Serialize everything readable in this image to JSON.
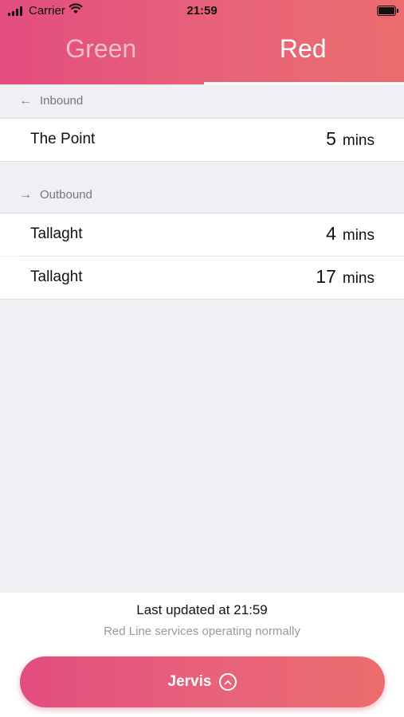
{
  "status_bar": {
    "carrier": "Carrier",
    "time": "21:59",
    "signal_icon": "cellular-signal-icon",
    "wifi_icon": "wifi-icon",
    "battery_icon": "battery-icon"
  },
  "tabs": [
    {
      "label": "Green",
      "active": false
    },
    {
      "label": "Red",
      "active": true
    }
  ],
  "inbound": {
    "label": "Inbound",
    "icon": "arrow-left-icon",
    "rows": [
      {
        "destination": "The Point",
        "due": "5",
        "unit": "mins"
      }
    ]
  },
  "outbound": {
    "label": "Outbound",
    "icon": "arrow-right-icon",
    "rows": [
      {
        "destination": "Tallaght",
        "due": "4",
        "unit": "mins"
      },
      {
        "destination": "Tallaght",
        "due": "17",
        "unit": "mins"
      }
    ]
  },
  "footer": {
    "last_updated": "Last updated at 21:59",
    "service_status": "Red Line services operating normally",
    "stop_button": {
      "label": "Jervis",
      "icon": "chevron-up-circle-icon"
    }
  },
  "colors": {
    "gradient_start": "#e24d7e",
    "gradient_end": "#ec6c6d",
    "background": "#efeff4"
  }
}
